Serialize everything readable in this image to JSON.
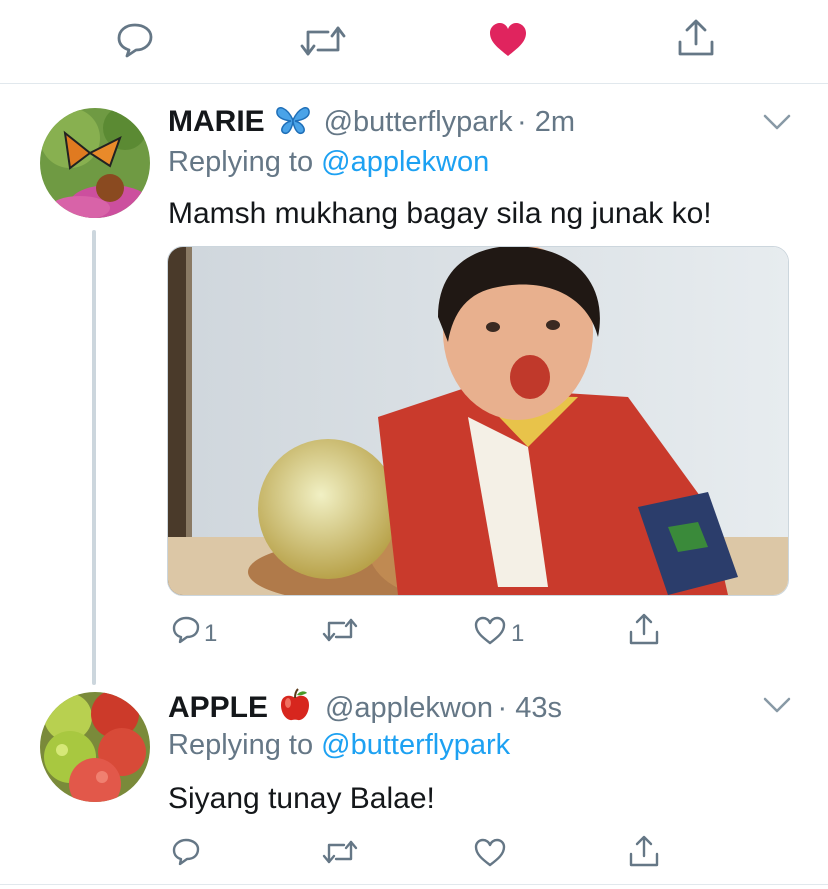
{
  "colors": {
    "text": "#14171a",
    "secondary": "#657786",
    "accent": "#1da1f2",
    "like_active": "#e0245e",
    "divider": "#e1e8ed",
    "thread_line": "#ccd6dd"
  },
  "top_actions": {
    "icons": [
      "reply-icon",
      "retweet-icon",
      "like-icon-filled",
      "share-icon"
    ]
  },
  "tweets": [
    {
      "name": "MARIE",
      "name_emoji": "butterfly-emoji",
      "handle": "@butterflypark",
      "time": "· 2m",
      "replying_prefix": "Replying to",
      "replying_to": "@applekwon",
      "text": "Mamsh mukhang bagay sila ng junak ko!",
      "has_media": true,
      "media_description": "child-photo",
      "reply_count": "1",
      "retweet_count": "",
      "like_count": "1"
    },
    {
      "name": "APPLE",
      "name_emoji": "red-apple-emoji",
      "handle": "@applekwon",
      "time": "· 43s",
      "replying_prefix": "Replying to",
      "replying_to": "@butterflypark",
      "text": "Siyang tunay Balae!",
      "has_media": false,
      "reply_count": "",
      "retweet_count": "",
      "like_count": ""
    }
  ]
}
